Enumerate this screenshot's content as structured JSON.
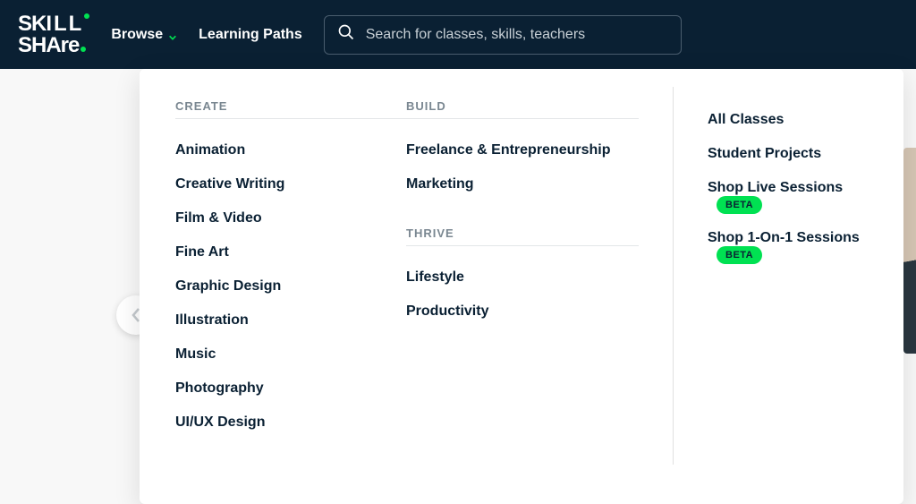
{
  "nav": {
    "browse": "Browse",
    "learning_paths": "Learning Paths"
  },
  "search": {
    "placeholder": "Search for classes, skills, teachers"
  },
  "dropdown": {
    "sections": {
      "create": {
        "title": "CREATE",
        "items": [
          "Animation",
          "Creative Writing",
          "Film & Video",
          "Fine Art",
          "Graphic Design",
          "Illustration",
          "Music",
          "Photography",
          "UI/UX Design"
        ]
      },
      "build": {
        "title": "BUILD",
        "items": [
          "Freelance & Entrepreneurship",
          "Marketing"
        ]
      },
      "thrive": {
        "title": "THRIVE",
        "items": [
          "Lifestyle",
          "Productivity"
        ]
      }
    },
    "right_links": [
      {
        "label": "All Classes",
        "badge": null
      },
      {
        "label": "Student Projects",
        "badge": null
      },
      {
        "label": "Shop Live Sessions",
        "badge": "BETA"
      },
      {
        "label": "Shop 1-On-1 Sessions",
        "badge": "BETA"
      }
    ]
  }
}
